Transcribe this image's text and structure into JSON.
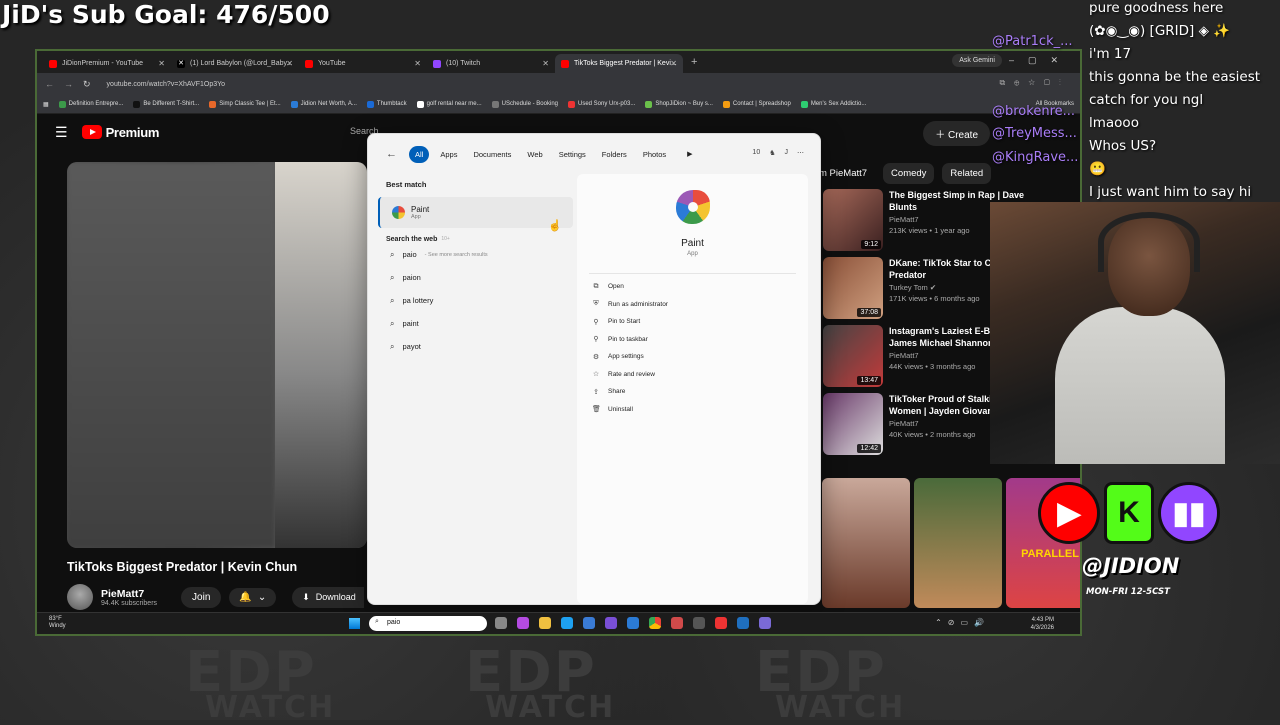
{
  "stream": {
    "sub_goal": "JiD's Sub Goal: 476/500",
    "watermark": [
      "EDP",
      "WATCH"
    ],
    "handle": "@JIDION",
    "schedule": "MON-FRI 12-5CST"
  },
  "chat": {
    "lines": [
      "pure goodness here",
      "(✿◉‿◉) [GRID] ◈ ✨",
      "i'm 17",
      "this gonna be the easiest",
      "catch for you ngl",
      "lmaooo",
      "Whos US?",
      "😬",
      "I just want him to say hi"
    ],
    "usernames": [
      "@Patr1ck_...",
      "@brokenre...",
      "@TreyMess...",
      "@KingRave..."
    ]
  },
  "browser": {
    "tabs": [
      {
        "label": "JiDionPremium - YouTube",
        "color": "#ff0000"
      },
      {
        "label": "(1) Lord Babylon (@Lord_Baby...",
        "color": "#ffffff"
      },
      {
        "label": "YouTube",
        "color": "#ff0000"
      },
      {
        "label": "(10) Twitch",
        "color": "#9146ff"
      },
      {
        "label": "TikToks Biggest Predator | Kevi...",
        "color": "#ff0000"
      }
    ],
    "ask_gemini": "Ask Gemini",
    "url": "youtube.com/watch?v=XhAVF1Op3Yo",
    "bookmarks": [
      "Definition Entrepre...",
      "Be Different T-Shirt...",
      "Simp Classic Tee | Et...",
      "Jidion Net Worth, A...",
      "Thumbtack",
      "golf rental near me...",
      "USchedule - Booking",
      "Used Sony Urx-p03...",
      "ShopJiDion ~ Buy s...",
      "Contact | Spreadshop",
      "Men's Sex Addictio..."
    ],
    "all_bookmarks": "All Bookmarks"
  },
  "youtube": {
    "logo": "Premium",
    "search_placeholder": "Search",
    "create": "Create",
    "video_title": "TikToks Biggest Predator | Kevin Chun",
    "channel": "PieMatt7",
    "subscribers": "94.4K subscribers",
    "join": "Join",
    "download": "Download",
    "chips": [
      "m PieMatt7",
      "Comedy",
      "Related"
    ],
    "recs": [
      {
        "title1": "The Biggest Simp in Rap | Dave",
        "title2": "Blunts",
        "channel": "PieMatt7",
        "meta": "213K views • 1 year ago",
        "dur": "9:12"
      },
      {
        "title1": "DKane: TikTok Star to Cl",
        "title2": "Predator",
        "channel": "Turkey Tom ✔",
        "meta": "171K views • 6 months ago",
        "dur": "37:08"
      },
      {
        "title1": "Instagram's Laziest E-Be",
        "title2": "James Michael Shannor",
        "channel": "PieMatt7",
        "meta": "44K views • 3 months ago",
        "dur": "13:47"
      },
      {
        "title1": "TikToker Proud of Stalki",
        "title2": "Women | Jayden Giovan",
        "channel": "PieMatt7",
        "meta": "40K views • 2 months ago",
        "dur": "12:42"
      }
    ],
    "shorts_label": "PARALLEL"
  },
  "startmenu": {
    "filters": [
      "All",
      "Apps",
      "Documents",
      "Web",
      "Settings",
      "Folders",
      "Photos"
    ],
    "right_count": "10",
    "right_initial": "J",
    "best_match_label": "Best match",
    "best_match": {
      "name": "Paint",
      "type": "App"
    },
    "web_label": "Search the web",
    "web_sub": "10+",
    "web_items": [
      {
        "text": "paio",
        "hint": "- See more search results"
      },
      {
        "text": "paion",
        "hint": ""
      },
      {
        "text": "pa lottery",
        "hint": ""
      },
      {
        "text": "paint",
        "hint": ""
      },
      {
        "text": "payot",
        "hint": ""
      }
    ],
    "detail": {
      "name": "Paint",
      "type": "App"
    },
    "actions": [
      "Open",
      "Run as administrator",
      "Pin to Start",
      "Pin to taskbar",
      "App settings",
      "Rate and review",
      "Share",
      "Uninstall"
    ]
  },
  "taskbar": {
    "weather_temp": "83°F",
    "weather_desc": "Windy",
    "search_value": "paio",
    "time": "4:43 PM",
    "date": "4/3/2026"
  }
}
